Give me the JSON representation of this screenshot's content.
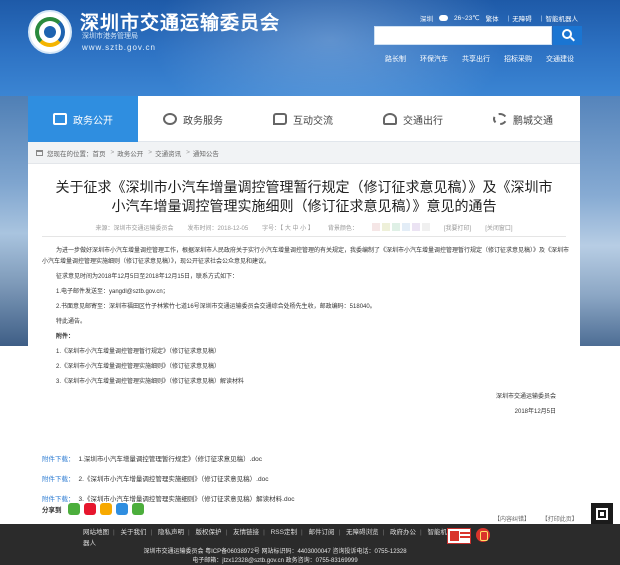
{
  "header": {
    "site_title": "深圳市交通运输委员会",
    "site_subtitle": "深圳市港务管理局",
    "site_url": "www.sztb.gov.cn",
    "top_links": {
      "city": "深圳",
      "weather": "26~23℃",
      "simplified": "繁体",
      "accessible": "无障碍",
      "robot": "智能机器人"
    },
    "search": {
      "placeholder": ""
    },
    "quick_links": [
      "路长制",
      "环保汽车",
      "共享出行",
      "招标采购",
      "交通建设"
    ]
  },
  "nav": {
    "items": [
      {
        "label": "政务公开",
        "icon": "document-icon",
        "active": true
      },
      {
        "label": "政务服务",
        "icon": "service-icon",
        "active": false
      },
      {
        "label": "互动交流",
        "icon": "chat-icon",
        "active": false
      },
      {
        "label": "交通出行",
        "icon": "travel-icon",
        "active": false
      },
      {
        "label": "鹏城交通",
        "icon": "city-icon",
        "active": false
      }
    ]
  },
  "breadcrumb": {
    "prefix": "您现在的位置：",
    "crumbs": [
      "首页",
      "政务公开",
      "交通资讯",
      "通知公告"
    ]
  },
  "article": {
    "title": "关于征求《深圳市小汽车增量调控管理暂行规定（修订征求意见稿）》及《深圳市小汽车增量调控管理实施细则（修订征求意见稿）》意见的通告",
    "meta": {
      "source": "来源：深圳市交通运输委员会",
      "date": "发布时间：2018-12-05",
      "font_size": "字号：【 大 中 小 】",
      "color_label": "背景颜色：",
      "print": "[我要打印]",
      "close": "[关闭窗口]"
    },
    "body": {
      "intro": "为进一步做好深圳市小汽车增量调控管理工作，根据深圳市人民政府关于实行小汽车增量调控管理的有关规定，我委编制了《深圳市小汽车增量调控管理暂行规定（修订征求意见稿）》及《深圳市小汽车增量调控管理实施细则（修订征求意见稿）》，现公开征求社会公众意见和建议。",
      "period": "征求意见时间为2018年12月5日至2018年12月15日，联系方式如下：",
      "email": "1.电子邮件发送至：yangdl@sztb.gov.cn；",
      "mail": "2.书面意见邮寄至：深圳市福田区竹子林紫竹七道16号深圳市交通运输委员会交通综合处杨先生收，邮政编码：518040。",
      "notice": "特此通告。",
      "attachments_label": "附件：",
      "attachment_list": [
        "1.《深圳市小汽车增量调控管理暂行规定》（修订征求意见稿）",
        "2.《深圳市小汽车增量调控管理实施细则》（修订征求意见稿）",
        "3.《深圳市小汽车增量调控管理实施细则》（修订征求意见稿）解读材料"
      ],
      "signature": "深圳市交通运输委员会",
      "sign_date": "2018年12月5日"
    },
    "downloads": [
      {
        "label": "附件下载：",
        "file": "1.深圳市小汽车增量调控管理暂行规定》（修订征求意见稿）.doc"
      },
      {
        "label": "附件下载：",
        "file": "2.《深圳市小汽车增量调控管理实施细则》（修订征求意见稿）.doc"
      },
      {
        "label": "附件下载：",
        "file": "3.《深圳市小汽车增量调控管理实施细则》（修订征求意见稿）解读材料.doc"
      }
    ],
    "share_label": "分享到",
    "share_icons": [
      {
        "name": "wechat-icon",
        "color": "#4cae3c"
      },
      {
        "name": "weibo-icon",
        "color": "#e6162d"
      },
      {
        "name": "qzone-icon",
        "color": "#f7a900"
      },
      {
        "name": "qq-icon",
        "color": "#2f8ee0"
      },
      {
        "name": "more-icon",
        "color": "#4cae3c"
      }
    ],
    "print_links": {
      "print": "【内容纠错】",
      "close": "【打印此页】"
    }
  },
  "footer": {
    "links": [
      "网站地图",
      "关于我们",
      "隐私声明",
      "版权保护",
      "友情链接",
      "RSS定制",
      "邮件订阅",
      "无障碍浏览",
      "政府办公",
      "智能机器人"
    ],
    "info_line1": "深圳市交通运输委员会 粤ICP备06038972号 网站标识码：4403000047 咨询投诉电话：0755-12328",
    "info_line2": "电子邮箱：jtzx12328@sztb.gov.cn 政务咨询：0755-83169999"
  },
  "colors": {
    "brand_blue": "#2f8ee0",
    "header_blue": "#1e5aa8",
    "link_blue": "#2f7dd3",
    "footer_bg": "#2b2b2b"
  },
  "background_swatches": [
    "#f5e6e6",
    "#eef0d9",
    "#dff0e6",
    "#e3edf7",
    "#ebe3f3",
    "#f0f0f0"
  ]
}
